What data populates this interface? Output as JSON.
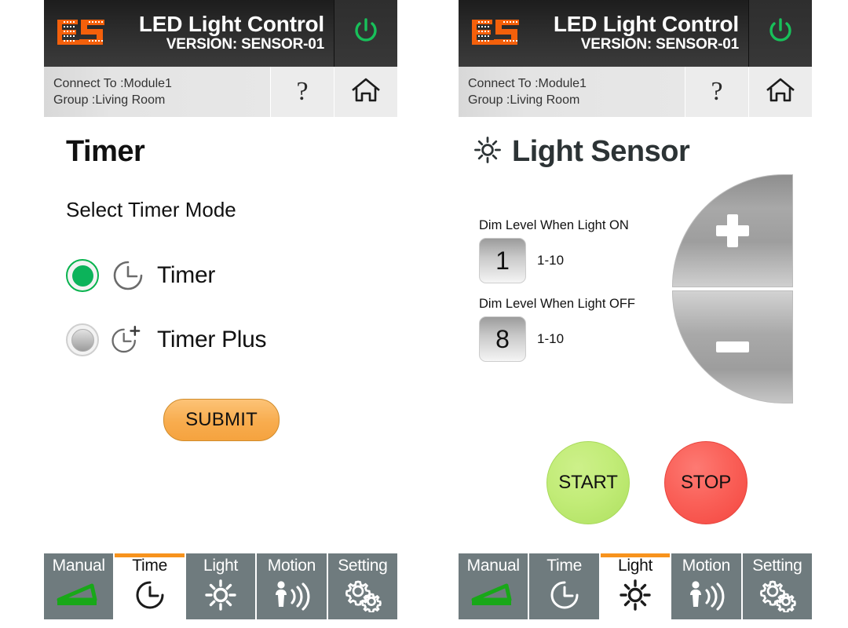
{
  "header": {
    "logo_icon": "es-pixel-logo",
    "title": "LED Light Control",
    "version": "VERSION: SENSOR-01",
    "power_icon": "power-icon",
    "help_label": "?",
    "help_icon": "question-mark-icon",
    "home_icon": "home-icon",
    "connect_line": "Connect To :Module1",
    "group_line": "Group :Living Room"
  },
  "left_panel": {
    "title": "Timer",
    "select_label": "Select Timer Mode",
    "options": [
      {
        "label": "Timer",
        "icon": "clock-icon",
        "selected": true
      },
      {
        "label": "Timer Plus",
        "icon": "clock-plus-icon",
        "selected": false
      }
    ],
    "submit_label": "SUBMIT",
    "active_tab": "Time"
  },
  "right_panel": {
    "title": "Light Sensor",
    "title_icon": "sun-icon",
    "dim_settings": [
      {
        "label": "Dim Level When Light ON",
        "value": "1",
        "range": "1-10"
      },
      {
        "label": "Dim Level When Light OFF",
        "value": "8",
        "range": "1-10"
      }
    ],
    "stepper": {
      "plus_icon": "plus-icon",
      "minus_icon": "minus-icon"
    },
    "start_label": "START",
    "stop_label": "STOP",
    "active_tab": "Light"
  },
  "nav_tabs": [
    {
      "label": "Manual",
      "icon": "dimmer-wedge-icon"
    },
    {
      "label": "Time",
      "icon": "clock-icon"
    },
    {
      "label": "Light",
      "icon": "sun-icon"
    },
    {
      "label": "Motion",
      "icon": "motion-sensor-icon"
    },
    {
      "label": "Setting",
      "icon": "gears-icon"
    }
  ],
  "colors": {
    "accent_orange": "#f7931d",
    "nav_gray": "#6f7b7e",
    "power_green": "#1db954",
    "radio_green": "#0cb35a",
    "start_green": "#c2ec78",
    "stop_red": "#fa6159",
    "submit_orange": "#f8ac4e",
    "logo_orange": "#f4600b"
  }
}
